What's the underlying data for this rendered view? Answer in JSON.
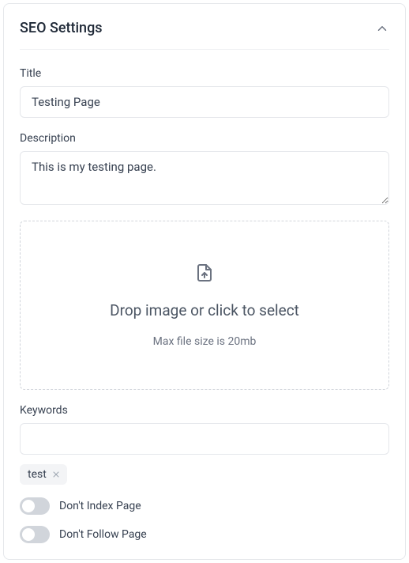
{
  "panel": {
    "title": "SEO Settings"
  },
  "fields": {
    "title_label": "Title",
    "title_value": "Testing Page",
    "description_label": "Description",
    "description_value": "This is my testing page.",
    "keywords_label": "Keywords",
    "keywords_value": ""
  },
  "dropzone": {
    "text": "Drop image or click to select",
    "subtext": "Max file size is 20mb"
  },
  "tags": [
    {
      "label": "test"
    }
  ],
  "toggles": {
    "noindex_label": "Don't Index Page",
    "noindex_on": false,
    "nofollow_label": "Don't Follow Page",
    "nofollow_on": false
  }
}
